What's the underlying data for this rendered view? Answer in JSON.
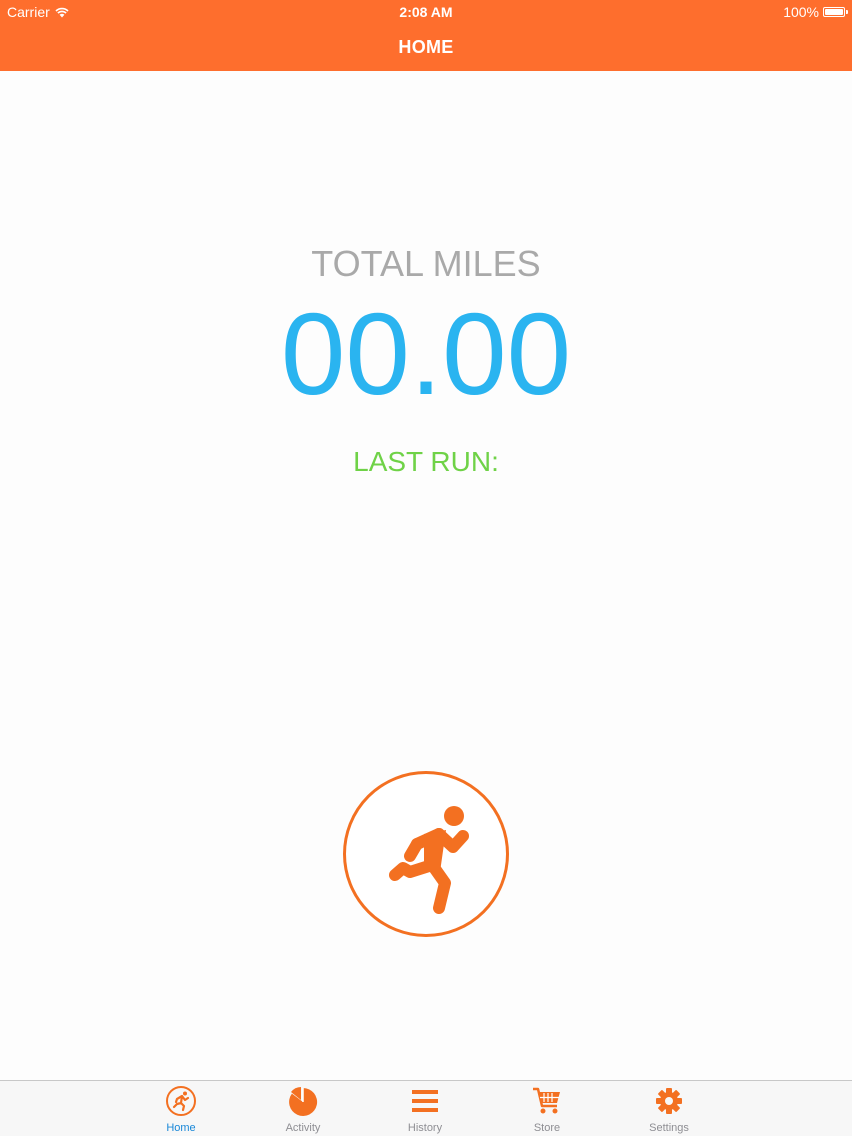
{
  "status_bar": {
    "carrier": "Carrier",
    "time": "2:08 AM",
    "battery": "100%"
  },
  "header": {
    "title": "HOME"
  },
  "stats": {
    "total_label": "TOTAL MILES",
    "total_value": "00.00",
    "last_run_label": "LAST RUN:"
  },
  "run_button": {
    "icon": "running-person-icon"
  },
  "tabs": [
    {
      "label": "Home",
      "icon": "running-person-icon",
      "active": true
    },
    {
      "label": "Activity",
      "icon": "pie-chart-icon",
      "active": false
    },
    {
      "label": "History",
      "icon": "list-icon",
      "active": false
    },
    {
      "label": "Store",
      "icon": "cart-icon",
      "active": false
    },
    {
      "label": "Settings",
      "icon": "gear-icon",
      "active": false
    }
  ],
  "colors": {
    "accent": "#fe6e2d",
    "icon_orange": "#f37021",
    "total_value": "#2ab4f0",
    "last_run": "#6fd247",
    "label_gray": "#a9a9a9",
    "active_tab": "#1a88d8"
  }
}
